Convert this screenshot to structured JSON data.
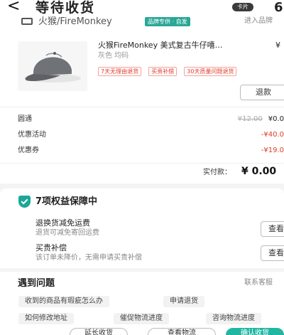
{
  "header": {
    "back_glyph": "<",
    "title": "等待收货",
    "card_pill": "卡片",
    "corner_glyph": "6"
  },
  "store": {
    "name": "火猴/FireMonkey",
    "badge": "品牌专供 · 自发",
    "enter_link": "进入品牌"
  },
  "product": {
    "title": "火猴FireMonkey 美式复古牛仔嘻…",
    "price": "¥",
    "spec": "灰色 均码",
    "tags": [
      "7天无理由退货",
      "买贵补偿",
      "30天质量问题退货"
    ],
    "refund_label": "退款"
  },
  "pricing": {
    "rows": [
      {
        "label": "圆通",
        "original": "¥12.00",
        "value": "¥0.0",
        "red": false
      },
      {
        "label": "优惠活动",
        "original": "",
        "value": "-¥40.0",
        "red": true
      },
      {
        "label": "优惠券",
        "original": "",
        "value": "-¥19.0",
        "red": true
      }
    ],
    "total_label": "实付款：",
    "total_value": "¥ 0.00"
  },
  "guarantee": {
    "title": "7项权益保障中",
    "items": [
      {
        "title": "退换货减免运费",
        "desc": "退货可减免寄回运费",
        "action": "查看"
      },
      {
        "title": "买贵补偿",
        "desc": "该订单未降价，无需申请买贵补偿",
        "action": "查看"
      }
    ]
  },
  "problems": {
    "title": "遇到问题",
    "contact_link": "联系客服",
    "chips": [
      "收到的商品有瑕疵怎么办",
      "申请退货",
      "如何修改地址",
      "催促物流进度",
      "咨询物流进度"
    ]
  },
  "bottom_bar": {
    "buttons": [
      "延长收货",
      "查看物流",
      "确认收货"
    ]
  },
  "colors": {
    "accent": "#21b6a2",
    "red": "#e03a2a"
  }
}
